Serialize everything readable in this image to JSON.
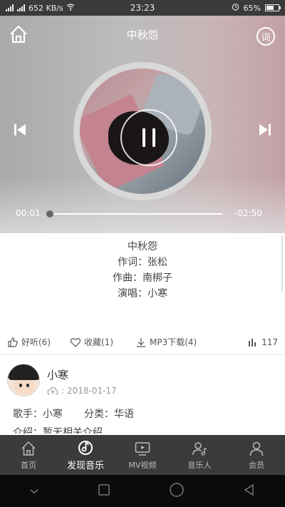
{
  "status_bar": {
    "speed": "652 KB/s",
    "time": "23:23",
    "battery": "65%",
    "battery_level": 0.65
  },
  "player": {
    "title": "中秋怨",
    "lyric_button": "词",
    "current_time": "00:01",
    "remaining_time": "-02:50",
    "progress": 0.0,
    "icons": [
      "home-icon",
      "lyric-icon",
      "prev-icon",
      "pause-icon",
      "next-icon"
    ]
  },
  "song_info": {
    "title": "中秋怨",
    "lyricist": "作词：张松",
    "composer": "作曲：南梆子",
    "singer": "演唱：小寒"
  },
  "actions": {
    "like": "好听(6)",
    "favorite": "收藏(1)",
    "download": "MP3下载(4)",
    "plays": "117"
  },
  "artist": {
    "name": "小寒",
    "date": "2018-01-17"
  },
  "meta": {
    "singer": "歌手：小寒",
    "category": "分类：华语",
    "intro": "介绍：暂无相关介绍"
  },
  "bottom_nav": {
    "items": [
      {
        "label": "首页",
        "icon": "home-icon"
      },
      {
        "label": "发现音乐",
        "icon": "music-note-icon"
      },
      {
        "label": "MV视频",
        "icon": "tv-icon"
      },
      {
        "label": "音乐人",
        "icon": "musician-icon"
      },
      {
        "label": "会员",
        "icon": "member-icon"
      }
    ],
    "active_index": 1
  },
  "colors": {
    "nav_bg": "#3b3b3b",
    "status_bg": "#3a3a3a",
    "system_nav_bg": "#0b0b0b"
  }
}
